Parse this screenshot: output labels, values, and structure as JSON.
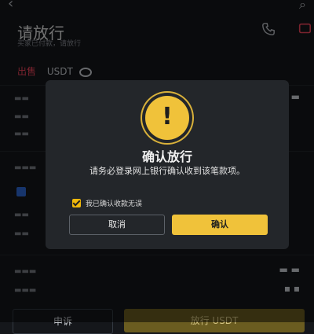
{
  "header": {
    "title": "请放行",
    "subtitle": "买家已付款，请放行"
  },
  "order": {
    "side": "出售",
    "asset": "USDT"
  },
  "bottom": {
    "complain_label": "申诉",
    "release_label": "放行 USDT"
  },
  "modal": {
    "title": "确认放行",
    "message": "请务必登录网上银行确认收到该笔款项。",
    "checkbox_label": "我已确认收款无误",
    "cancel_label": "取消",
    "confirm_label": "确认"
  },
  "colors": {
    "accent": "#f0c23a",
    "sell": "#f6465d",
    "modal_bg": "#23262a",
    "page_bg": "#15171b"
  }
}
